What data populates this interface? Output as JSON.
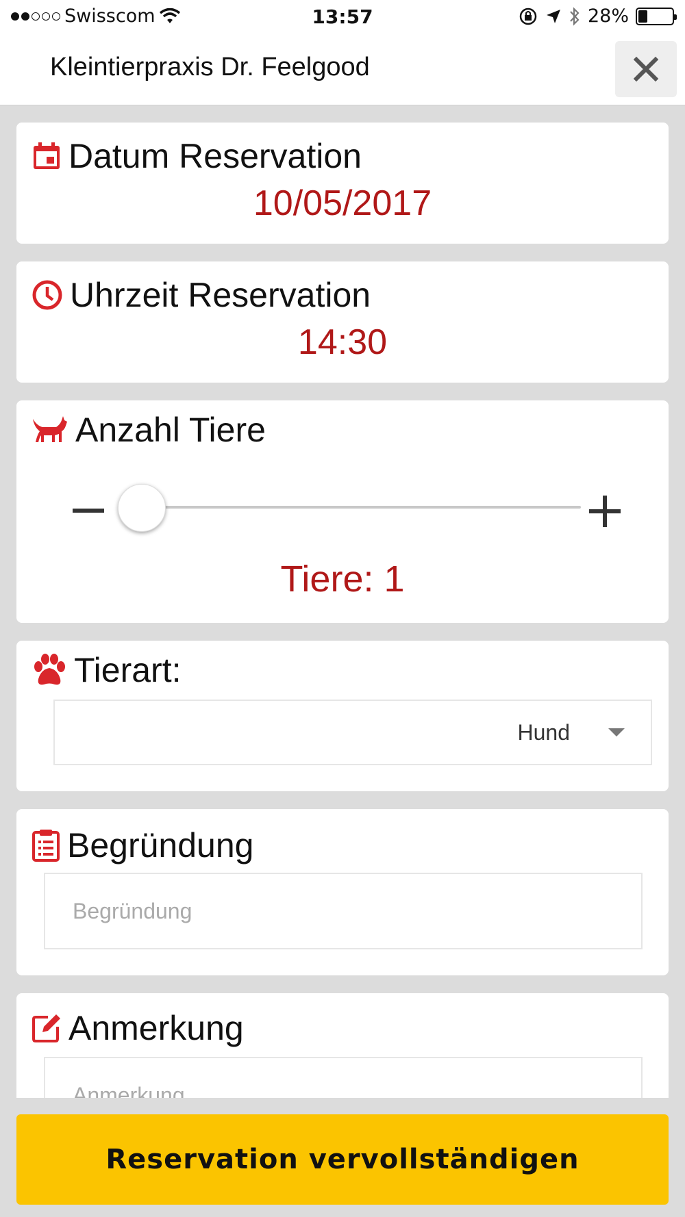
{
  "status_bar": {
    "carrier": "Swisscom",
    "time": "13:57",
    "battery": "28%",
    "battery_level": 0.28
  },
  "header": {
    "title": "Kleintierpraxis Dr. Feelgood"
  },
  "date_card": {
    "title": "Datum Reservation",
    "value": "10/05/2017"
  },
  "time_card": {
    "title": "Uhrzeit Reservation",
    "value": "14:30"
  },
  "animals_card": {
    "title": "Anzahl Tiere",
    "count_label": "Tiere: 1",
    "slider_value": 1
  },
  "species_card": {
    "title": "Tierart:",
    "selected": "Hund"
  },
  "reason_card": {
    "title": "Begründung",
    "placeholder": "Begründung"
  },
  "note_card": {
    "title": "Anmerkung",
    "placeholder": "Anmerkung"
  },
  "submit": {
    "label": "Reservation vervollständigen"
  },
  "colors": {
    "accent_red": "#d9262b",
    "value_red": "#b01818",
    "button_yellow": "#fbc400"
  }
}
